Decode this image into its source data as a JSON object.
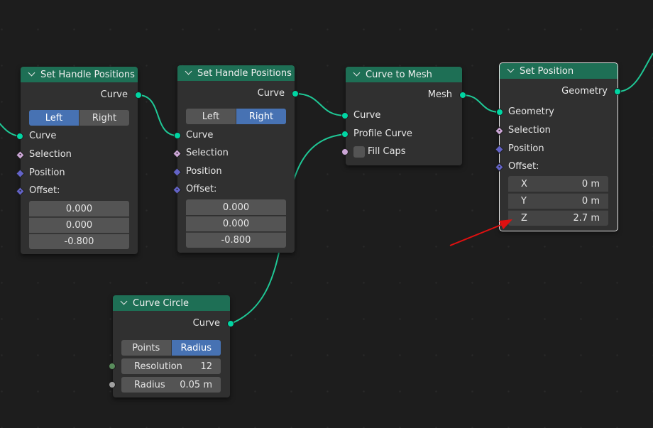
{
  "colors": {
    "background": "#1d1d1d",
    "node_body": "#303030",
    "node_header": "#1e6f55",
    "wire": "#1fc896",
    "geometry_socket": "#00d6a3",
    "vector_socket": "#6363c7",
    "boolean_socket": "#cca6d6",
    "integer_socket": "#598c5c",
    "float_socket": "#a1a1a1",
    "active_toggle": "#4772b3",
    "annotation_arrow": "#e01010"
  },
  "nodes": {
    "handle1": {
      "title": "Set Handle Positions",
      "output": "Curve",
      "mode_left": "Left",
      "mode_right": "Right",
      "mode_selected": "Left",
      "inputs": {
        "curve": "Curve",
        "selection": "Selection",
        "position": "Position",
        "offset": "Offset:"
      },
      "offset": [
        "0.000",
        "0.000",
        "-0.800"
      ]
    },
    "handle2": {
      "title": "Set Handle Positions",
      "output": "Curve",
      "mode_left": "Left",
      "mode_right": "Right",
      "mode_selected": "Right",
      "inputs": {
        "curve": "Curve",
        "selection": "Selection",
        "position": "Position",
        "offset": "Offset:"
      },
      "offset": [
        "0.000",
        "0.000",
        "-0.800"
      ]
    },
    "curve_to_mesh": {
      "title": "Curve to Mesh",
      "output": "Mesh",
      "inputs": {
        "curve": "Curve",
        "profile": "Profile Curve",
        "fill_caps": "Fill Caps"
      }
    },
    "set_position": {
      "title": "Set Position",
      "output": "Geometry",
      "inputs": {
        "geometry": "Geometry",
        "selection": "Selection",
        "position": "Position",
        "offset": "Offset:"
      },
      "offset": [
        {
          "axis": "X",
          "value": "0 m"
        },
        {
          "axis": "Y",
          "value": "0 m"
        },
        {
          "axis": "Z",
          "value": "2.7 m"
        }
      ]
    },
    "curve_circle": {
      "title": "Curve Circle",
      "output": "Curve",
      "mode_left": "Points",
      "mode_right": "Radius",
      "mode_selected": "Radius",
      "resolution_label": "Resolution",
      "resolution_value": "12",
      "radius_label": "Radius",
      "radius_value": "0.05 m"
    }
  }
}
